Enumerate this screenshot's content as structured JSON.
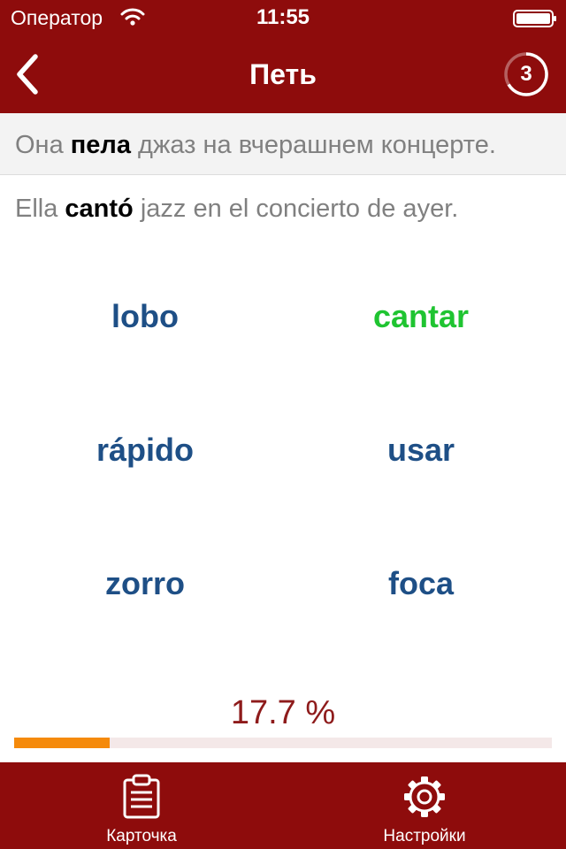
{
  "status": {
    "carrier": "Оператор",
    "time": "11:55",
    "wifi_icon": "wifi-icon",
    "battery_icon": "battery-icon"
  },
  "nav": {
    "back_icon": "chevron-left-icon",
    "title": "Петь",
    "timer_value": "3",
    "timer_icon": "countdown-ring-icon"
  },
  "prompt": {
    "before": "Она ",
    "highlight": "пела",
    "after": " джаз на вчерашнем концерте."
  },
  "example": {
    "before": "Ella ",
    "highlight": "cantó",
    "after": " jazz en el concierto de ayer."
  },
  "answers": [
    {
      "label": "lobo",
      "state": "default"
    },
    {
      "label": "cantar",
      "state": "correct"
    },
    {
      "label": "rápido",
      "state": "default"
    },
    {
      "label": "usar",
      "state": "default"
    },
    {
      "label": "zorro",
      "state": "default"
    },
    {
      "label": "foca",
      "state": "default"
    }
  ],
  "progress": {
    "label": "17.7 %",
    "fraction": 0.177
  },
  "tabs": [
    {
      "label": "Карточка",
      "icon": "clipboard-icon"
    },
    {
      "label": "Настройки",
      "icon": "gear-icon"
    }
  ],
  "colors": {
    "brand": "#8e0c0c",
    "answer": "#1e4f86",
    "correct": "#1fc431",
    "progress_fill": "#f58a0b",
    "progress_text": "#8e1b1b"
  }
}
